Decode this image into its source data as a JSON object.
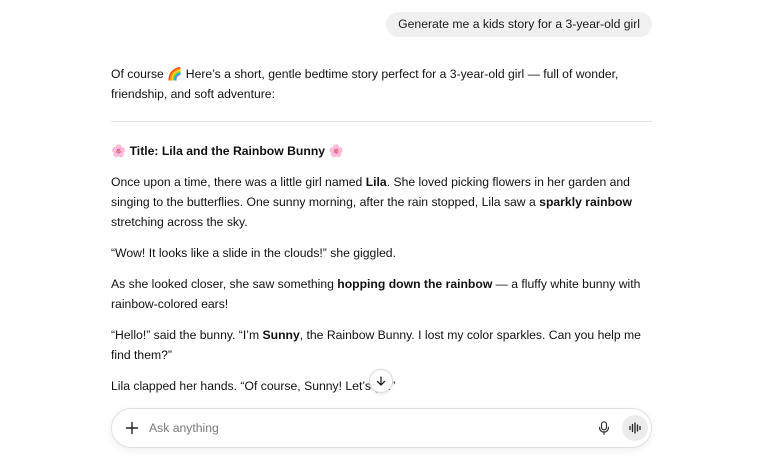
{
  "user_message": "Generate me a kids story for a 3-year-old girl",
  "answer": {
    "intro": "Of course 🌈 Here’s a short, gentle bedtime story perfect for a 3-year-old girl — full of wonder, friendship, and soft adventure:",
    "title_emoji_left": "🌸",
    "title": "Title: Lila and the Rainbow Bunny",
    "title_emoji_right": "🌸",
    "p1_a": "Once upon a time, there was a little girl named ",
    "p1_b": "Lila",
    "p1_c": ". She loved picking flowers in her garden and singing to the butterflies. One sunny morning, after the rain stopped, Lila saw a ",
    "p1_d": "sparkly rainbow",
    "p1_e": " stretching across the sky.",
    "p2": "“Wow! It looks like a slide in the clouds!” she giggled.",
    "p3_a": "As she looked closer, she saw something ",
    "p3_b": "hopping down the rainbow",
    "p3_c": " — a fluffy white bunny with rainbow-colored ears!",
    "p4_a": "“Hello!” said the bunny. “I’m ",
    "p4_b": "Sunny",
    "p4_c": ", the Rainbow Bunny. I lost my color sparkles. Can you help me find them?”",
    "p5": "Lila clapped her hands. “Of course, Sunny! Let’s go!”"
  },
  "composer": {
    "placeholder": "Ask anything",
    "icons": [
      "plus-icon",
      "microphone-icon",
      "voice-mode-icon"
    ]
  },
  "scroll_button": {
    "icon": "arrow-down-icon"
  }
}
